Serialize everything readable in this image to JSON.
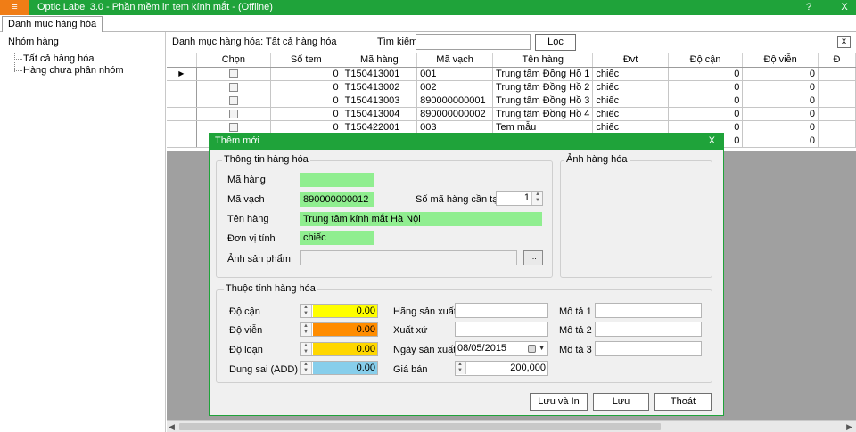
{
  "window": {
    "menu_icon": "≡",
    "title": "Optic Label 3.0 - Phần mềm in tem kính mắt - (Offline)",
    "help": "?",
    "minimize": "-",
    "close": "X"
  },
  "tabs": [
    {
      "label": "Danh mục hàng hóa"
    }
  ],
  "left_panel": {
    "heading": "Nhóm hàng",
    "tree": [
      {
        "label": "Tất cả hàng hóa"
      },
      {
        "label": "Hàng chưa phân nhóm"
      }
    ]
  },
  "toolbar": {
    "label": "Danh mục hàng hóa: Tất cả hàng hóa",
    "search_label": "Tìm kiếm",
    "search_value": "",
    "filter_label": "Lọc",
    "close_label": "x"
  },
  "grid": {
    "columns": [
      "Chọn",
      "Số tem",
      "Mã hàng",
      "Mã vạch",
      "Tên hàng",
      "Đvt",
      "Độ cận",
      "Độ viễn",
      "Đ"
    ],
    "rows": [
      {
        "marker": "▶",
        "so_tem": "0",
        "ma_hang": "T150413001",
        "ma_vach": "001",
        "ten_hang": "Trung tâm Đồng Hồ 1",
        "dvt": "chiếc",
        "do_can": "0",
        "do_vien": "0"
      },
      {
        "marker": "",
        "so_tem": "0",
        "ma_hang": "T150413002",
        "ma_vach": "002",
        "ten_hang": "Trung tâm Đồng Hồ 2",
        "dvt": "chiếc",
        "do_can": "0",
        "do_vien": "0"
      },
      {
        "marker": "",
        "so_tem": "0",
        "ma_hang": "T150413003",
        "ma_vach": "890000000001",
        "ten_hang": "Trung tâm Đồng Hồ 3",
        "dvt": "chiếc",
        "do_can": "0",
        "do_vien": "0"
      },
      {
        "marker": "",
        "so_tem": "0",
        "ma_hang": "T150413004",
        "ma_vach": "890000000002",
        "ten_hang": "Trung tâm Đồng Hồ 4",
        "dvt": "chiếc",
        "do_can": "0",
        "do_vien": "0"
      },
      {
        "marker": "",
        "so_tem": "0",
        "ma_hang": "T150422001",
        "ma_vach": "003",
        "ten_hang": "Tem mẫu",
        "dvt": "chiếc",
        "do_can": "0",
        "do_vien": "0"
      },
      {
        "marker": "",
        "so_tem": "",
        "ma_hang": "",
        "ma_vach": "",
        "ten_hang": "",
        "dvt": "",
        "do_can": "0",
        "do_vien": "0"
      }
    ]
  },
  "dialog": {
    "title": "Thêm mới",
    "close": "X",
    "info_group": "Thông tin hàng hóa",
    "image_group": "Ảnh hàng hóa",
    "attr_group": "Thuộc tính hàng hóa",
    "fields": {
      "ma_hang": {
        "label": "Mã hàng",
        "value": ""
      },
      "ma_vach": {
        "label": "Mã vạch",
        "value": "890000000012"
      },
      "so_ma": {
        "label": "Số mã hàng cần tạo",
        "value": "1"
      },
      "ten_hang": {
        "label": "Tên hàng",
        "value": "Trung tâm kính mắt Hà Nội"
      },
      "don_vi": {
        "label": "Đơn vị tính",
        "value": "chiếc"
      },
      "anh": {
        "label": "Ảnh sản phẩm",
        "value": "",
        "browse": "..."
      }
    },
    "attrs": {
      "do_can": {
        "label": "Độ cận",
        "value": "0.00",
        "color": "#ffff00"
      },
      "do_vien": {
        "label": "Độ viễn",
        "value": "0.00",
        "color": "#ff8c00"
      },
      "do_loan": {
        "label": "Độ loạn",
        "value": "0.00",
        "color": "#ffd700"
      },
      "dung_sai": {
        "label": "Dung sai (ADD)",
        "value": "0.00",
        "color": "#87ceeb"
      },
      "hang_sx": {
        "label": "Hãng sản xuất",
        "value": ""
      },
      "xuat_xu": {
        "label": "Xuất xứ",
        "value": ""
      },
      "ngay_sx": {
        "label": "Ngày sản xuất",
        "value": "08/05/2015"
      },
      "gia_ban": {
        "label": "Giá bán",
        "value": "200,000"
      },
      "mo_ta_1": {
        "label": "Mô tả 1",
        "value": ""
      },
      "mo_ta_2": {
        "label": "Mô tả 2",
        "value": ""
      },
      "mo_ta_3": {
        "label": "Mô tả 3",
        "value": ""
      }
    },
    "buttons": {
      "save_print": "Lưu và In",
      "save": "Lưu",
      "exit": "Thoát"
    }
  },
  "colors": {
    "accent": "#1fa33a",
    "menu_button": "#f07d16",
    "field_green": "#90ee90"
  }
}
